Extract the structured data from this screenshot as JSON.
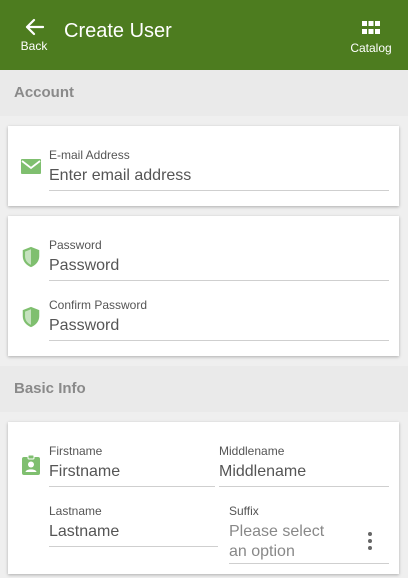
{
  "header": {
    "back_label": "Back",
    "title": "Create User",
    "catalog_label": "Catalog"
  },
  "colors": {
    "header_bg": "#4d7c1f",
    "icon_green": "#7fbf6f",
    "section_text": "#8a8a8a"
  },
  "account": {
    "section_title": "Account",
    "email": {
      "label": "E-mail Address",
      "placeholder": "Enter email address",
      "icon": "mail-icon"
    },
    "password": {
      "label": "Password",
      "placeholder": "Password",
      "icon": "shield-icon"
    },
    "confirm_password": {
      "label": "Confirm Password",
      "placeholder": "Password",
      "icon": "shield-icon"
    }
  },
  "basic_info": {
    "section_title": "Basic Info",
    "firstname": {
      "label": "Firstname",
      "placeholder": "Firstname",
      "icon": "id-badge-icon"
    },
    "middlename": {
      "label": "Middlename",
      "placeholder": "Middlename"
    },
    "lastname": {
      "label": "Lastname",
      "placeholder": "Lastname"
    },
    "suffix": {
      "label": "Suffix",
      "placeholder": "Please select an option"
    }
  }
}
